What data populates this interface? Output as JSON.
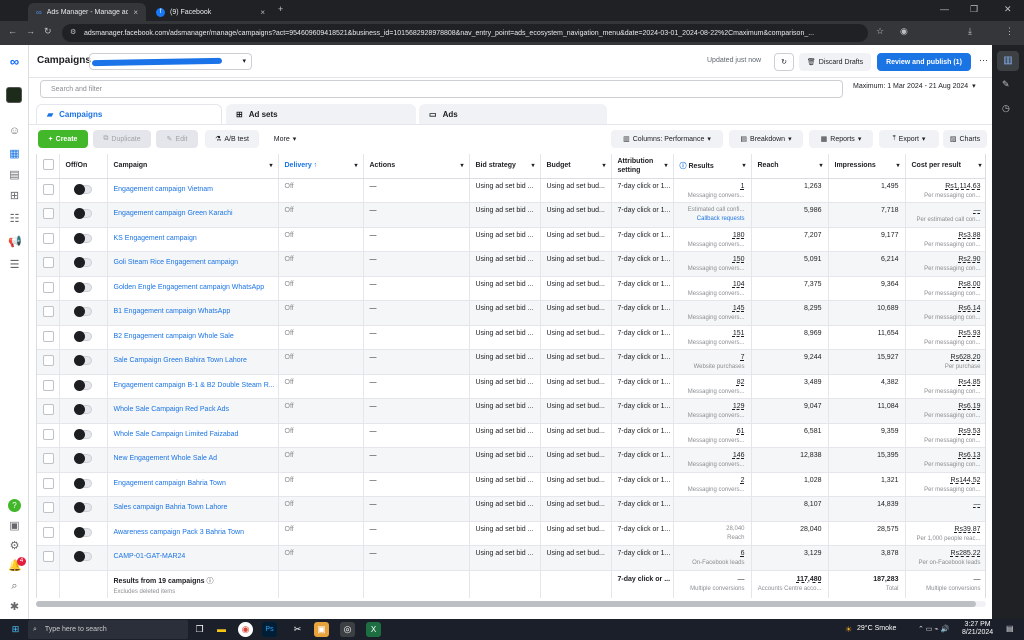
{
  "browser": {
    "tabs": [
      {
        "title": "Ads Manager - Manage ads - C"
      },
      {
        "title": "(9) Facebook"
      }
    ],
    "url": "adsmanager.facebook.com/adsmanager/manage/campaigns?act=954609609418521&business_id=1015682928978808&nav_entry_point=ads_ecosystem_navigation_menu&date=2024-03-01_2024-08-22%2Cmaximum&comparison_..."
  },
  "header": {
    "title": "Campaigns",
    "updated": "Updated just now",
    "discard": "Discard Drafts",
    "review": "Review and publish (1)"
  },
  "search": {
    "placeholder": "Search and filter",
    "date_range": "Maximum: 1 Mar 2024 - 21 Aug 2024"
  },
  "tabs": {
    "campaigns": "Campaigns",
    "adsets": "Ad sets",
    "ads": "Ads"
  },
  "toolbar": {
    "create": "Create",
    "duplicate": "Duplicate",
    "edit": "Edit",
    "abtest": "A/B test",
    "more": "More",
    "columns": "Columns: Performance",
    "breakdown": "Breakdown",
    "reports": "Reports",
    "export": "Export",
    "charts": "Charts"
  },
  "table": {
    "headers": [
      "Off/On",
      "Campaign",
      "Delivery ↑",
      "Actions",
      "Bid strategy",
      "Budget",
      "Attribution setting",
      "Results",
      "Reach",
      "Impressions",
      "Cost per result"
    ],
    "rows": [
      {
        "name": "Engagement campaign Vietnam",
        "delivery": "Off",
        "actions": "—",
        "bid": "Using ad set bid ...",
        "budget": "Using ad set bud...",
        "attr": "7-day click or 1...",
        "results": "1",
        "results_sub": "Messaging convers...",
        "reach": "1,263",
        "impr": "1,495",
        "cost": "Rs1,114.63",
        "cost_sub": "Per messaging con..."
      },
      {
        "name": "Engagement campaign Green Karachi",
        "delivery": "Off",
        "actions": "—",
        "bid": "Using ad set bid ...",
        "budget": "Using ad set bud...",
        "attr": "7-day click or 1...",
        "results": "Estimated call confi...",
        "results_sub": "Callback requests",
        "reach": "5,986",
        "impr": "7,718",
        "cost": "—",
        "cost_sub": "Per estimated call con..."
      },
      {
        "name": "KS Engagement campaign",
        "delivery": "Off",
        "actions": "—",
        "bid": "Using ad set bid ...",
        "budget": "Using ad set bud...",
        "attr": "7-day click or 1...",
        "results": "180",
        "results_sub": "Messaging convers...",
        "reach": "7,207",
        "impr": "9,177",
        "cost": "Rs3.88",
        "cost_sub": "Per messaging con..."
      },
      {
        "name": "Goli Steam Rice Engagement campaign",
        "delivery": "Off",
        "actions": "—",
        "bid": "Using ad set bid ...",
        "budget": "Using ad set bud...",
        "attr": "7-day click or 1...",
        "results": "150",
        "results_sub": "Messaging convers...",
        "reach": "5,091",
        "impr": "6,214",
        "cost": "Rs2.90",
        "cost_sub": "Per messaging con..."
      },
      {
        "name": "Golden Engle Engagement campaign WhatsApp",
        "delivery": "Off",
        "actions": "—",
        "bid": "Using ad set bid ...",
        "budget": "Using ad set bud...",
        "attr": "7-day click or 1...",
        "results": "104",
        "results_sub": "Messaging convers...",
        "reach": "7,375",
        "impr": "9,364",
        "cost": "Rs8.00",
        "cost_sub": "Per messaging con..."
      },
      {
        "name": "B1 Engagement campaign WhatsApp",
        "delivery": "Off",
        "actions": "—",
        "bid": "Using ad set bid ...",
        "budget": "Using ad set bud...",
        "attr": "7-day click or 1...",
        "results": "145",
        "results_sub": "Messaging convers...",
        "reach": "8,295",
        "impr": "10,689",
        "cost": "Rs6.14",
        "cost_sub": "Per messaging con..."
      },
      {
        "name": "B2 Engagement campaign Whole Sale",
        "delivery": "Off",
        "actions": "—",
        "bid": "Using ad set bid ...",
        "budget": "Using ad set bud...",
        "attr": "7-day click or 1...",
        "results": "151",
        "results_sub": "Messaging convers...",
        "reach": "8,969",
        "impr": "11,654",
        "cost": "Rs5.93",
        "cost_sub": "Per messaging con..."
      },
      {
        "name": "Sale Campaign Green Bahira Town Lahore",
        "delivery": "Off",
        "actions": "—",
        "bid": "Using ad set bid ...",
        "budget": "Using ad set bud...",
        "attr": "7-day click or 1...",
        "results": "7",
        "results_sub": "Website purchases",
        "reach": "9,244",
        "impr": "15,927",
        "cost": "Rs628.20",
        "cost_sub": "Per purchase"
      },
      {
        "name": "Engagement campaign B-1 & B2 Double Steam R...",
        "delivery": "Off",
        "actions": "—",
        "bid": "Using ad set bid ...",
        "budget": "Using ad set bud...",
        "attr": "7-day click or 1...",
        "results": "82",
        "results_sub": "Messaging convers...",
        "reach": "3,489",
        "impr": "4,382",
        "cost": "Rs4.85",
        "cost_sub": "Per messaging con..."
      },
      {
        "name": "Whole Sale Campaign Red Pack Ads",
        "delivery": "Off",
        "actions": "—",
        "bid": "Using ad set bid ...",
        "budget": "Using ad set bud...",
        "attr": "7-day click or 1...",
        "results": "129",
        "results_sub": "Messaging convers...",
        "reach": "9,047",
        "impr": "11,084",
        "cost": "Rs6.19",
        "cost_sub": "Per messaging con..."
      },
      {
        "name": "Whole Sale Campaign Limited Faizabad",
        "delivery": "Off",
        "actions": "—",
        "bid": "Using ad set bid ...",
        "budget": "Using ad set bud...",
        "attr": "7-day click or 1...",
        "results": "61",
        "results_sub": "Messaging convers...",
        "reach": "6,581",
        "impr": "9,359",
        "cost": "Rs9.53",
        "cost_sub": "Per messaging con..."
      },
      {
        "name": "New Engagement Whole Sale Ad",
        "delivery": "Off",
        "actions": "—",
        "bid": "Using ad set bid ...",
        "budget": "Using ad set bud...",
        "attr": "7-day click or 1...",
        "results": "146",
        "results_sub": "Messaging convers...",
        "reach": "12,838",
        "impr": "15,395",
        "cost": "Rs6.13",
        "cost_sub": "Per messaging con..."
      },
      {
        "name": "Engagement campaign Bahria Town",
        "delivery": "Off",
        "actions": "—",
        "bid": "Using ad set bid ...",
        "budget": "Using ad set bud...",
        "attr": "7-day click or 1...",
        "results": "2",
        "results_sub": "Messaging convers...",
        "reach": "1,028",
        "impr": "1,321",
        "cost": "Rs144.52",
        "cost_sub": "Per messaging con..."
      },
      {
        "name": "Sales campaign Bahria Town Lahore",
        "delivery": "Off",
        "actions": "—",
        "bid": "Using ad set bid ...",
        "budget": "Using ad set bud...",
        "attr": "7-day click or 1...",
        "results": "",
        "results_sub": "",
        "reach": "8,107",
        "impr": "14,839",
        "cost": "—",
        "cost_sub": ""
      },
      {
        "name": "Awareness campaign Pack 3 Bahria Town",
        "delivery": "Off",
        "actions": "—",
        "bid": "Using ad set bid ...",
        "budget": "Using ad set bud...",
        "attr": "7-day click or 1...",
        "results": "28,040",
        "results_sub": "Reach",
        "reach": "28,040",
        "impr": "28,575",
        "cost": "Rs39.87",
        "cost_sub": "Per 1,000 people reac..."
      },
      {
        "name": "CAMP-01-GAT-MAR24",
        "delivery": "Off",
        "actions": "—",
        "bid": "Using ad set bid ...",
        "budget": "Using ad set bud...",
        "attr": "7-day click or 1...",
        "results": "6",
        "results_sub": "On-Facebook leads",
        "reach": "3,129",
        "impr": "3,878",
        "cost": "Rs285.22",
        "cost_sub": "Per on-Facebook leads"
      }
    ],
    "total": {
      "label": "Results from 19 campaigns",
      "sub": "Excludes deleted items",
      "attr": "7-day click or ...",
      "results": "—",
      "results_sub": "Multiple conversions",
      "reach": "117,480",
      "reach_sub": "Accounts Centre acco...",
      "impr": "187,283",
      "impr_sub": "Total",
      "cost": "—",
      "cost_sub": "Multiple conversions"
    }
  },
  "taskbar": {
    "search_placeholder": "Type here to search",
    "weather": "29°C  Smoke",
    "time": "3:27 PM",
    "date": "8/21/2024"
  },
  "colors": {
    "accent": "#1b74e4",
    "create": "#42b72a"
  }
}
